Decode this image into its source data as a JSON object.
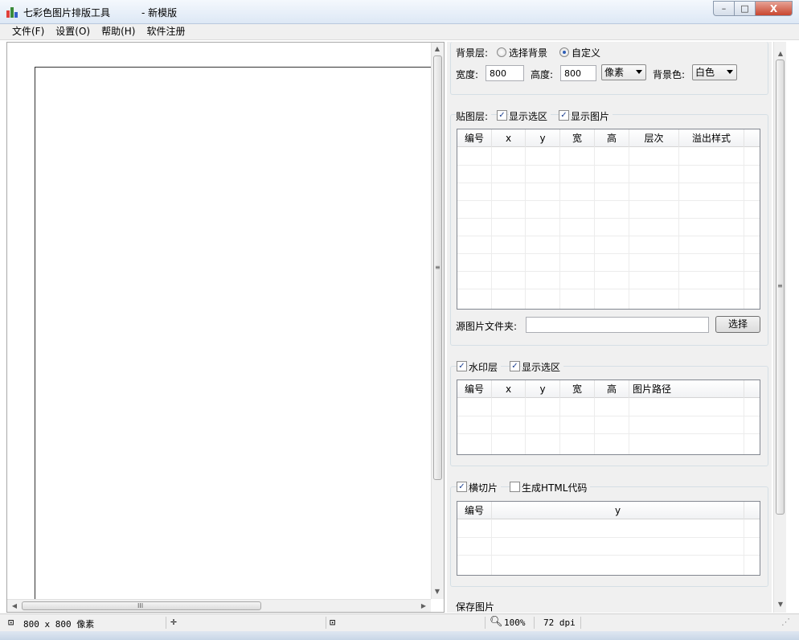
{
  "window": {
    "title": "七彩色图片排版工具",
    "subtitle": "- 新模版",
    "minimize_label": "–",
    "maximize_label": "□",
    "close_label": "X"
  },
  "menu": [
    {
      "label": "文件(F)"
    },
    {
      "label": "设置(O)"
    },
    {
      "label": "帮助(H)"
    },
    {
      "label": "软件注册"
    }
  ],
  "canvas": {
    "hscroll_grip": "III",
    "vscroll_grip": "≡"
  },
  "background_layer": {
    "label": "背景层:",
    "option_background": "选择背景",
    "option_custom": "自定义",
    "selected": "custom",
    "width_label": "宽度:",
    "width_value": "800",
    "height_label": "高度:",
    "height_value": "800",
    "unit": "像素",
    "bgcolor_label": "背景色:",
    "bgcolor": "白色"
  },
  "paste_layer": {
    "label": "贴图层:",
    "show_selection": "显示选区",
    "show_selection_checked": true,
    "show_image": "显示图片",
    "show_image_checked": true,
    "columns": [
      "编号",
      "x",
      "y",
      "宽",
      "高",
      "层次",
      "溢出样式"
    ],
    "source_folder_label": "源图片文件夹:",
    "source_folder_value": "",
    "select_button": "选择"
  },
  "watermark_layer": {
    "label": "水印层",
    "checked": true,
    "show_selection": "显示选区",
    "show_selection_checked": true,
    "columns": [
      "编号",
      "x",
      "y",
      "宽",
      "高",
      "图片路径"
    ]
  },
  "slice": {
    "label": "横切片",
    "checked": true,
    "gen_html": "生成HTML代码",
    "gen_html_checked": false,
    "columns": [
      "编号",
      "y"
    ]
  },
  "save": {
    "label": "保存图片"
  },
  "status": {
    "size": "800 x 800 像素",
    "zoom": "100%",
    "dpi": "72 dpi"
  }
}
